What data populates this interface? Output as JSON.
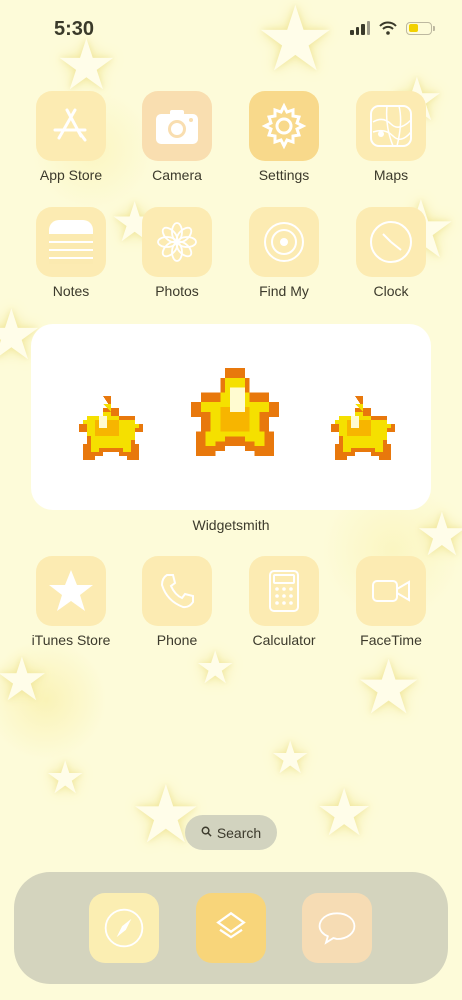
{
  "status_bar": {
    "time": "5:30"
  },
  "apps_row1": [
    {
      "label": "App Store",
      "icon": "app-store-icon"
    },
    {
      "label": "Camera",
      "icon": "camera-icon"
    },
    {
      "label": "Settings",
      "icon": "gear-icon"
    },
    {
      "label": "Maps",
      "icon": "map-icon"
    }
  ],
  "apps_row2": [
    {
      "label": "Notes",
      "icon": "notes-icon"
    },
    {
      "label": "Photos",
      "icon": "flower-icon"
    },
    {
      "label": "Find My",
      "icon": "radar-icon"
    },
    {
      "label": "Clock",
      "icon": "clock-icon"
    }
  ],
  "widget": {
    "label": "Widgetsmith"
  },
  "apps_row3": [
    {
      "label": "iTunes Store",
      "icon": "star-icon"
    },
    {
      "label": "Phone",
      "icon": "phone-icon"
    },
    {
      "label": "Calculator",
      "icon": "calculator-icon"
    },
    {
      "label": "FaceTime",
      "icon": "video-camera-icon"
    }
  ],
  "search": {
    "label": "Search"
  },
  "dock": [
    {
      "icon": "compass-icon"
    },
    {
      "icon": "shortcuts-icon"
    },
    {
      "icon": "chat-bubble-icon"
    }
  ],
  "colors": {
    "wallpaper": "#fdfbd9",
    "tile": "#fbeab0",
    "widget": "#ffffff",
    "dock": "#d4d4be",
    "star_yellow": "#f5e000",
    "star_orange": "#e8780c"
  }
}
